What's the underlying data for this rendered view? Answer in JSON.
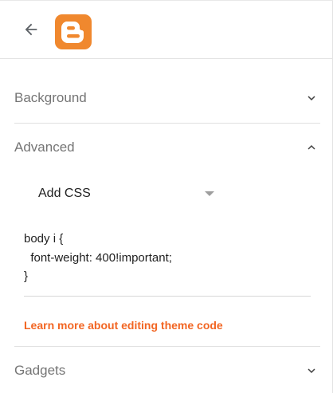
{
  "header": {
    "back_icon": "arrow-left-icon",
    "logo_icon": "blogger-logo-icon",
    "brand_color": "#f0882e"
  },
  "sections": {
    "background": {
      "label": "Background",
      "expanded": false,
      "chevron_icon": "chevron-down-icon"
    },
    "advanced": {
      "label": "Advanced",
      "expanded": true,
      "chevron_icon": "chevron-up-icon",
      "selector_value": "Add CSS",
      "css_code": "body i {\n  font-weight: 400!important;\n}",
      "help_link": "Learn more about editing theme code"
    },
    "gadgets": {
      "label": "Gadgets",
      "expanded": false,
      "chevron_icon": "chevron-down-icon"
    }
  },
  "colors": {
    "link": "#f26522",
    "label": "#757575",
    "text": "#212121"
  }
}
